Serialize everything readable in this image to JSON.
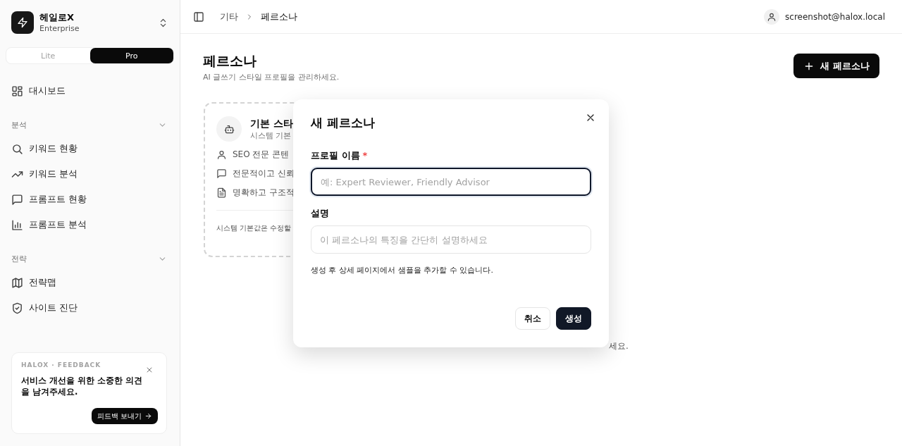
{
  "sidebar": {
    "brand": {
      "name": "헤일로X",
      "plan": "Enterprise"
    },
    "plan_toggle": [
      {
        "label": "Lite",
        "selected": false
      },
      {
        "label": "Pro",
        "selected": true
      }
    ],
    "sections": [
      {
        "items": [
          {
            "label": "대시보드",
            "kind": "grid",
            "selected": false
          }
        ]
      },
      {
        "title": "분석",
        "expanded": true,
        "items": [
          {
            "label": "키워드 현황",
            "kind": "search",
            "selected": false
          },
          {
            "label": "키워드 분석",
            "kind": "trend",
            "selected": false
          },
          {
            "label": "프롬프트 현황",
            "kind": "chat",
            "selected": false
          },
          {
            "label": "프롬프트 분석",
            "kind": "bars",
            "selected": false
          }
        ]
      },
      {
        "title": "전략",
        "expanded": true,
        "items": [
          {
            "label": "전략맵",
            "kind": "map",
            "selected": false
          },
          {
            "label": "사이트 진단",
            "kind": "shield",
            "selected": false
          }
        ]
      }
    ],
    "feedback": {
      "eyebrow": "HALOX · FEEDBACK",
      "message": "서비스 개선을 위한 소중한 의견을 남겨주세요.",
      "button": "피드백 보내기"
    }
  },
  "header": {
    "breadcrumb": [
      "기타",
      "페르소나"
    ],
    "user": "screenshot@halox.local"
  },
  "page": {
    "title": "페르소나",
    "subtitle": "AI 글쓰기 스타일 프로필을 관리하세요.",
    "new_button": "새 페르소나",
    "default_card": {
      "title": "기본 스타",
      "subtitle": "시스템 기본",
      "traits": [
        {
          "kind": "user",
          "text": "SEO 전문 콘텐"
        },
        {
          "kind": "chat",
          "text": "전문적이고 신뢰"
        },
        {
          "kind": "doc",
          "text": "명확하고 구조적"
        }
      ],
      "note": "시스템 기본값은 수정할"
    },
    "empty_hint": "세요."
  },
  "dialog": {
    "title": "새 페르소나",
    "fields": [
      {
        "label": "프로필 이름",
        "required_mark": "*",
        "placeholder": "예: Expert Reviewer, Friendly Advisor",
        "focused": true
      },
      {
        "label": "설명",
        "placeholder": "이 페르소나의 특징을 간단히 설명하세요",
        "focused": false
      }
    ],
    "help": "생성 후 상세 페이지에서 샘플을 추가할 수 있습니다.",
    "buttons": [
      {
        "label": "취소",
        "kind": "secondary"
      },
      {
        "label": "생성",
        "kind": "primary"
      }
    ]
  }
}
